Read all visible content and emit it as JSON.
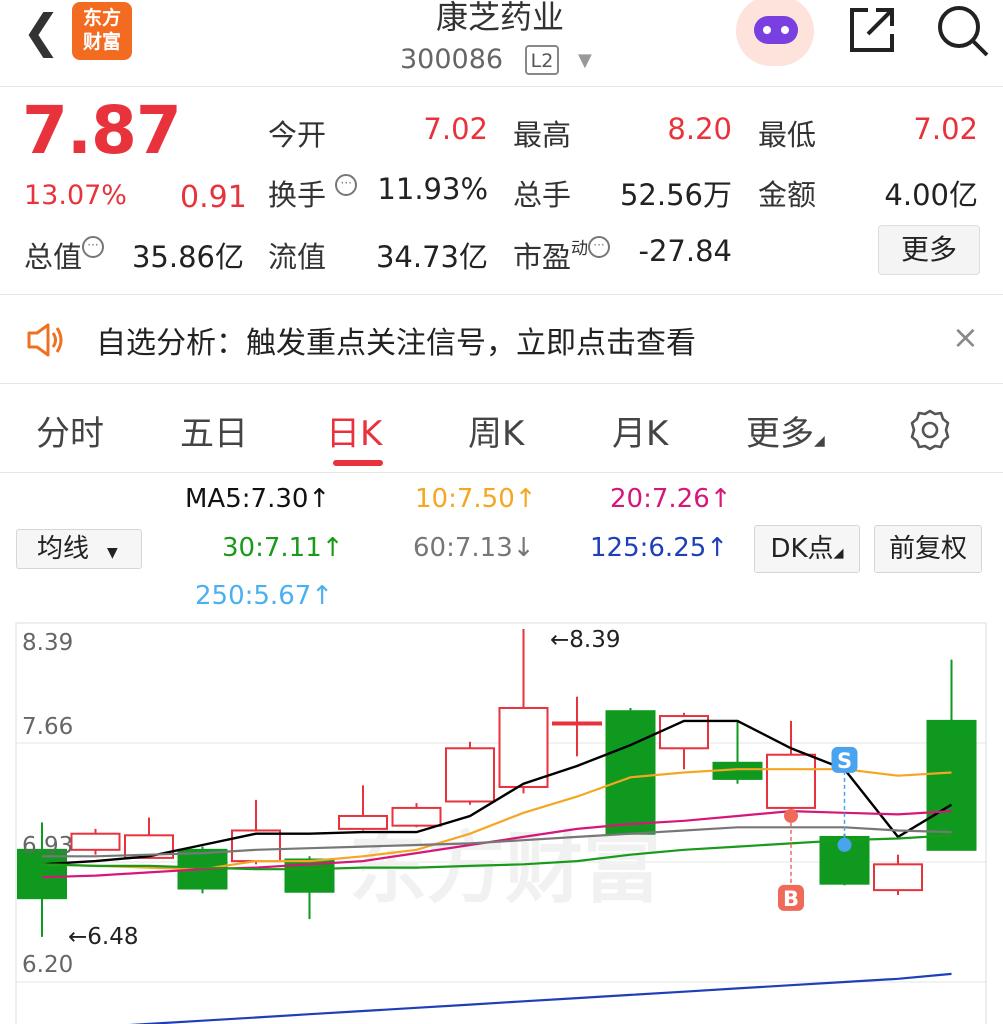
{
  "header": {
    "back_icon": "chevron-left-icon",
    "logo_line1": "东方",
    "logo_line2": "财富",
    "stock_name": "康芝药业",
    "stock_code": "300086",
    "level_badge": "L2",
    "share_icon": "share-icon",
    "search_icon": "search-icon"
  },
  "quote": {
    "price": "7.87",
    "change_pct": "13.07%",
    "change_amt": "0.91",
    "open_label": "今开",
    "open": "7.02",
    "high_label": "最高",
    "high": "8.20",
    "low_label": "最低",
    "low": "7.02",
    "turnover_label": "换手",
    "turnover": "11.93%",
    "volume_label": "总手",
    "volume": "52.56万",
    "amount_label": "金额",
    "amount": "4.00亿",
    "mktcap_label": "总值",
    "mktcap": "35.86亿",
    "float_label": "流值",
    "float_cap": "34.73亿",
    "pe_label": "市盈",
    "pe_sup": "动",
    "pe": "-27.84",
    "more_button": "更多"
  },
  "notice": {
    "text": "自选分析：触发重点关注信号，立即点击查看",
    "close": "×"
  },
  "tabs": [
    {
      "label": "分时"
    },
    {
      "label": "五日"
    },
    {
      "label": "日K"
    },
    {
      "label": "周K"
    },
    {
      "label": "月K"
    },
    {
      "label": "更多"
    }
  ],
  "ma": {
    "selector": "均线",
    "ma5": "MA5:7.30↑",
    "ma10": "10:7.50↑",
    "ma20": "20:7.26↑",
    "ma30": "30:7.11↑",
    "ma60": "60:7.13↓",
    "ma125": "125:6.25↑",
    "ma250": "250:5.67↑",
    "dk_button": "DK点",
    "fq_button": "前复权"
  },
  "colors": {
    "up": "#e8323c",
    "down": "#0f9a1f",
    "ma5": "#000000",
    "ma10": "#f5a623",
    "ma20": "#d6177a",
    "ma30": "#1a9a1a",
    "ma60": "#777777",
    "ma125": "#1f3fb8",
    "ma250": "#4ab0f0"
  },
  "chart_data": {
    "type": "candlestick",
    "y_ticks": [
      "8.39",
      "7.66",
      "6.93",
      "6.20"
    ],
    "ylim": [
      6.2,
      8.39
    ],
    "max_label": "←8.39",
    "min_label": "←6.48",
    "watermark": "东方财富",
    "candles": [
      {
        "open": 7.02,
        "close": 6.72,
        "high": 7.19,
        "low": 6.48
      },
      {
        "open": 7.02,
        "close": 7.12,
        "high": 7.15,
        "low": 6.99
      },
      {
        "open": 6.97,
        "close": 7.11,
        "high": 7.22,
        "low": 6.97
      },
      {
        "open": 7.02,
        "close": 6.78,
        "high": 7.04,
        "low": 6.75
      },
      {
        "open": 6.95,
        "close": 7.14,
        "high": 7.33,
        "low": 6.93
      },
      {
        "open": 6.96,
        "close": 6.76,
        "high": 6.98,
        "low": 6.59
      },
      {
        "open": 7.15,
        "close": 7.23,
        "high": 7.42,
        "low": 7.14
      },
      {
        "open": 7.17,
        "close": 7.28,
        "high": 7.31,
        "low": 7.16
      },
      {
        "open": 7.32,
        "close": 7.65,
        "high": 7.69,
        "low": 7.3
      },
      {
        "open": 7.41,
        "close": 7.9,
        "high": 8.39,
        "low": 7.37
      },
      {
        "open": 7.81,
        "close": 7.81,
        "high": 7.97,
        "low": 7.6
      },
      {
        "open": 7.88,
        "close": 7.12,
        "high": 7.9,
        "low": 7.44
      },
      {
        "open": 7.65,
        "close": 7.85,
        "high": 7.87,
        "low": 7.52
      },
      {
        "open": 7.56,
        "close": 7.46,
        "high": 7.82,
        "low": 7.43
      },
      {
        "open": 7.28,
        "close": 7.61,
        "high": 7.82,
        "low": 7.26
      },
      {
        "open": 7.1,
        "close": 6.81,
        "high": 7.12,
        "low": 6.8
      },
      {
        "open": 6.77,
        "close": 6.93,
        "high": 6.99,
        "low": 6.74
      },
      {
        "open": 7.82,
        "close": 7.02,
        "high": 8.2,
        "low": 7.02
      }
    ],
    "ma_lines": {
      "ma5": [
        6.93,
        6.95,
        6.98,
        7.05,
        7.12,
        7.12,
        7.13,
        7.13,
        7.23,
        7.43,
        7.54,
        7.67,
        7.82,
        7.82,
        7.65,
        7.52,
        7.1,
        7.3
      ],
      "ma10": [
        6.93,
        6.92,
        6.91,
        6.9,
        6.95,
        6.95,
        6.98,
        7.02,
        7.12,
        7.25,
        7.35,
        7.47,
        7.5,
        7.52,
        7.52,
        7.52,
        7.48,
        7.5
      ],
      "ma20": [
        6.85,
        6.86,
        6.88,
        6.9,
        6.91,
        6.93,
        6.95,
        7.0,
        7.05,
        7.1,
        7.15,
        7.18,
        7.2,
        7.23,
        7.26,
        7.25,
        7.24,
        7.26
      ],
      "ma30": [
        6.93,
        6.92,
        6.92,
        6.91,
        6.9,
        6.9,
        6.91,
        6.91,
        6.92,
        6.93,
        6.95,
        6.99,
        7.02,
        7.04,
        7.06,
        7.08,
        7.09,
        7.11
      ],
      "ma60": [
        6.98,
        6.98,
        6.99,
        7.0,
        7.02,
        7.03,
        7.04,
        7.05,
        7.06,
        7.08,
        7.1,
        7.12,
        7.14,
        7.16,
        7.16,
        7.16,
        7.14,
        7.13
      ],
      "ma125": [
        5.9,
        5.92,
        5.94,
        5.96,
        5.98,
        6.0,
        6.02,
        6.04,
        6.06,
        6.08,
        6.1,
        6.12,
        6.14,
        6.16,
        6.18,
        6.2,
        6.22,
        6.25
      ]
    },
    "markers": [
      {
        "label": "B",
        "candle": 14
      },
      {
        "label": "S",
        "candle": 15
      }
    ]
  }
}
